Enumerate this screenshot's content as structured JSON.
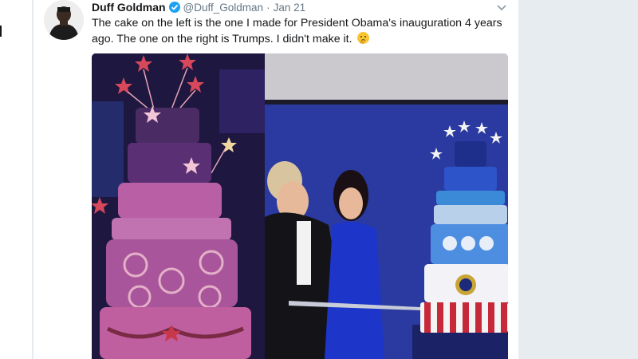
{
  "tweet": {
    "author_name": "Duff Goldman",
    "handle": "@Duff_Goldman",
    "separator": "·",
    "date": "Jan 21",
    "text": "The cake on the left is the one I made for President Obama's inauguration 4 years ago. The one on the right is Trumps. I didn't make it.",
    "emoji": "thinking-face-emoji"
  },
  "media": {
    "left_photo": "obama-inauguration-cake-photo",
    "right_photo": "trump-inauguration-cake-photo"
  },
  "colors": {
    "verified_blue": "#1da1f2",
    "text_dark": "#14171a",
    "text_gray": "#657786",
    "page_bg": "#e6ecf0"
  },
  "icons": {
    "verified": "verified-badge-icon",
    "menu": "chevron-down-icon"
  }
}
